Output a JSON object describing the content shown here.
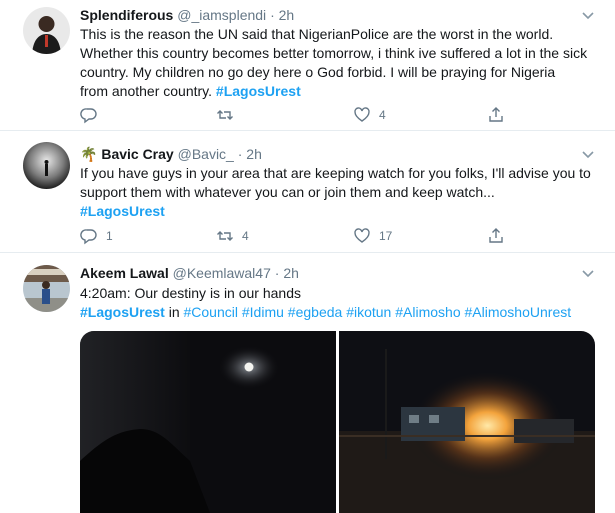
{
  "tweets": [
    {
      "name": "Splendiferous",
      "name_emoji": "",
      "handle": "@_iamsplendi",
      "dot": "·",
      "time": "2h",
      "lines": [
        "This is the reason the UN said that NigerianPolice are the worst in the world.",
        "Whether this country becomes better tomorrow, i think ive suffered a lot in the sick",
        "country. My children no go dey here o God forbid. I will be praying for Nigeria"
      ],
      "last_line_text": "from another country. ",
      "last_line_tag": "#LagosUrest",
      "reply_count": "",
      "retweet_count": "",
      "like_count": "4"
    },
    {
      "name": "Bavic Cray",
      "name_emoji": "🌴",
      "handle": "@Bavic_",
      "dot": "·",
      "time": "2h",
      "lines": [
        "If you have guys in your area that are keeping watch for you folks, I'll advise you to",
        "support them with whatever you can or join them and keep watch..."
      ],
      "tag_line": "#LagosUrest",
      "reply_count": "1",
      "retweet_count": "4",
      "like_count": "17"
    },
    {
      "name": "Akeem Lawal",
      "handle": "@Keemlawal47",
      "dot": "·",
      "time": "2h",
      "line1": "4:20am: Our destiny is in our hands",
      "line2_tag": "#LagosUrest",
      "line2_in": " in ",
      "hashtags": [
        "#Council",
        "#Idimu",
        "#egbeda",
        "#ikotun",
        "#Alimosho",
        "#AlimoshoUnrest"
      ]
    }
  ],
  "icons": {
    "reply": "reply-icon",
    "retweet": "retweet-icon",
    "like": "heart-icon",
    "share": "share-icon",
    "caret": "chevron-down-icon"
  },
  "colors": {
    "link": "#1da1f2",
    "secondary_text": "#657786",
    "divider": "#e6ecf0"
  }
}
